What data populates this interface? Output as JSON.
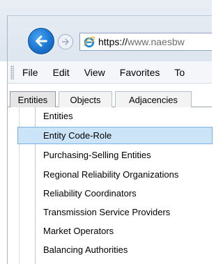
{
  "navigation": {
    "url_host": "https://",
    "url_rest": "www.naesbw"
  },
  "menu_bar": {
    "items": [
      "File",
      "Edit",
      "View",
      "Favorites",
      "To"
    ]
  },
  "tabs": [
    {
      "label": "Entities",
      "active": true
    },
    {
      "label": "Objects",
      "active": false
    },
    {
      "label": "Adjacencies",
      "active": false
    }
  ],
  "dropdown": {
    "items": [
      {
        "label": "Entities",
        "selected": false
      },
      {
        "label": "Entity Code-Role",
        "selected": true
      },
      {
        "label": "Purchasing-Selling Entities",
        "selected": false
      },
      {
        "label": "Regional Reliability Organizations",
        "selected": false
      },
      {
        "label": "Reliability Coordinators",
        "selected": false
      },
      {
        "label": "Transmission Service Providers",
        "selected": false
      },
      {
        "label": "Market Operators",
        "selected": false
      },
      {
        "label": "Balancing Authorities",
        "selected": false
      }
    ]
  },
  "colors": {
    "selection_bg": "#cce4f7",
    "selection_border": "#7ab1e2",
    "back_button": "#1b74d1"
  },
  "icons": {
    "back": "arrow-left-icon",
    "forward": "arrow-right-icon",
    "site": "ie-logo-icon"
  }
}
